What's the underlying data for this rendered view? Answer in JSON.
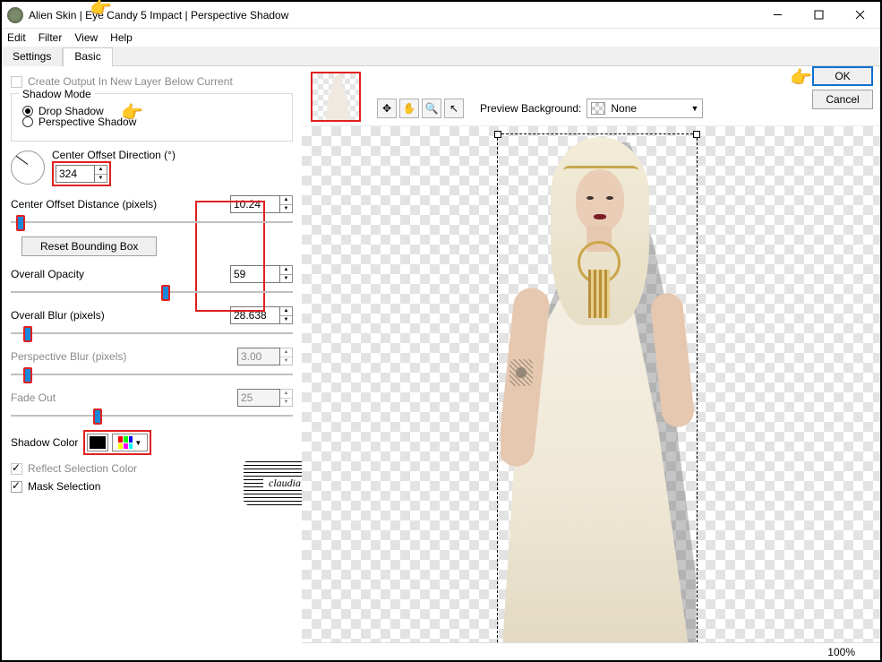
{
  "window": {
    "title": "Alien Skin | Eye Candy 5 Impact | Perspective Shadow"
  },
  "menu": {
    "edit": "Edit",
    "filter": "Filter",
    "view": "View",
    "help": "Help"
  },
  "tabs": {
    "settings": "Settings",
    "basic": "Basic"
  },
  "basic": {
    "create_output": "Create Output In New Layer Below Current",
    "shadow_mode_title": "Shadow Mode",
    "drop_shadow": "Drop Shadow",
    "perspective_shadow": "Perspective Shadow",
    "center_offset_dir_label": "Center Offset Direction (°)",
    "center_offset_dir_value": "324",
    "center_offset_dist_label": "Center Offset Distance (pixels)",
    "center_offset_dist_value": "10.24",
    "reset_bbox": "Reset Bounding Box",
    "overall_opacity_label": "Overall Opacity",
    "overall_opacity_value": "59",
    "overall_blur_label": "Overall Blur (pixels)",
    "overall_blur_value": "28.638",
    "perspective_blur_label": "Perspective Blur (pixels)",
    "perspective_blur_value": "3.00",
    "fade_out_label": "Fade Out",
    "fade_out_value": "25",
    "shadow_color_label": "Shadow Color",
    "shadow_color_value": "#000000",
    "reflect_sel_color": "Reflect Selection Color",
    "mask_selection": "Mask Selection"
  },
  "toolbar_icons": {
    "nav": "✥",
    "hand": "✋",
    "zoom": "🔍",
    "pointer": "↖"
  },
  "preview": {
    "label": "Preview Background:",
    "selected": "None"
  },
  "dialog": {
    "ok": "OK",
    "cancel": "Cancel"
  },
  "status": {
    "zoom": "100%"
  },
  "watermark": "claudia"
}
